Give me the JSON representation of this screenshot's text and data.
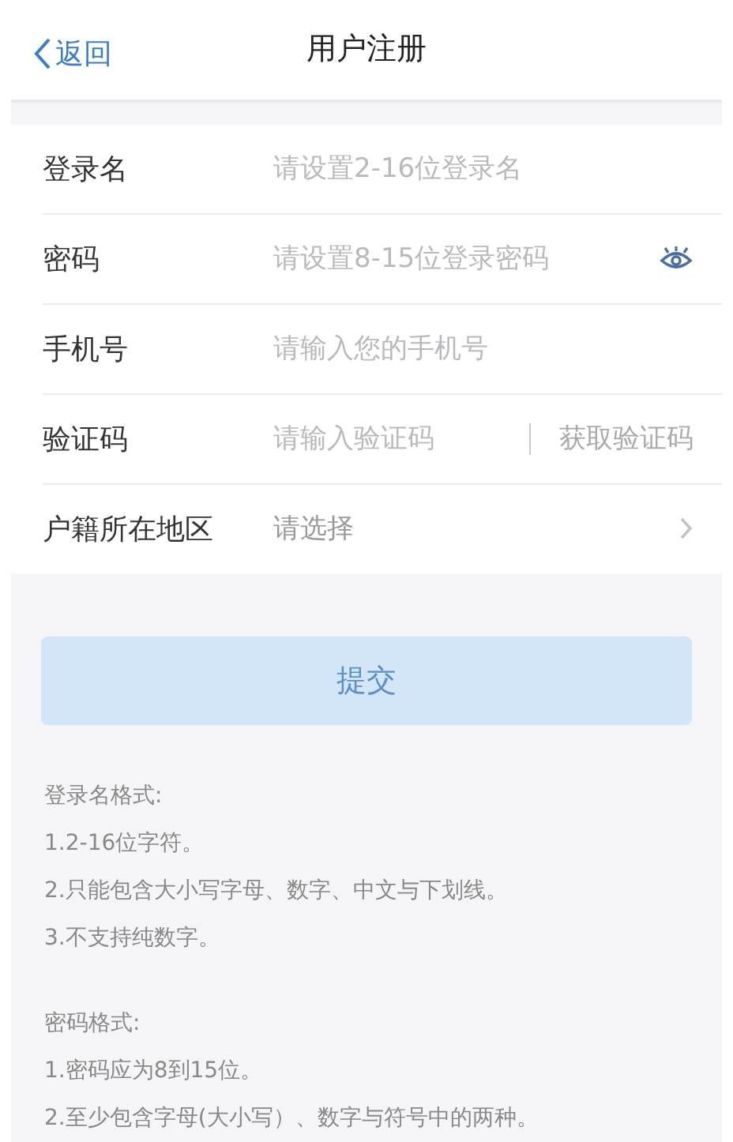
{
  "header": {
    "back": "返回",
    "title": "用户注册"
  },
  "fields": [
    {
      "kind": "text",
      "label": "登录名",
      "placeholder": "请设置2-16位登录名"
    },
    {
      "kind": "password",
      "label": "密码",
      "placeholder": "请设置8-15位登录密码"
    },
    {
      "kind": "text",
      "label": "手机号",
      "placeholder": "请输入您的手机号"
    },
    {
      "kind": "code",
      "label": "验证码",
      "placeholder": "请输入验证码",
      "action": "获取验证码"
    },
    {
      "kind": "select",
      "label": "户籍所在地区",
      "value": "请选择"
    }
  ],
  "submit": {
    "label": "提交",
    "disabled": true
  },
  "rules": [
    {
      "heading": "登录名格式:",
      "lines": [
        "1.2-16位字符。",
        "2.只能包含大小写字母、数字、中文与下划线。",
        "3.不支持纯数字。"
      ]
    },
    {
      "heading": "密码格式:",
      "lines": [
        "1.密码应为8到15位。",
        "2.至少包含字母(大小写）、数字与符号中的两种。"
      ]
    }
  ]
}
